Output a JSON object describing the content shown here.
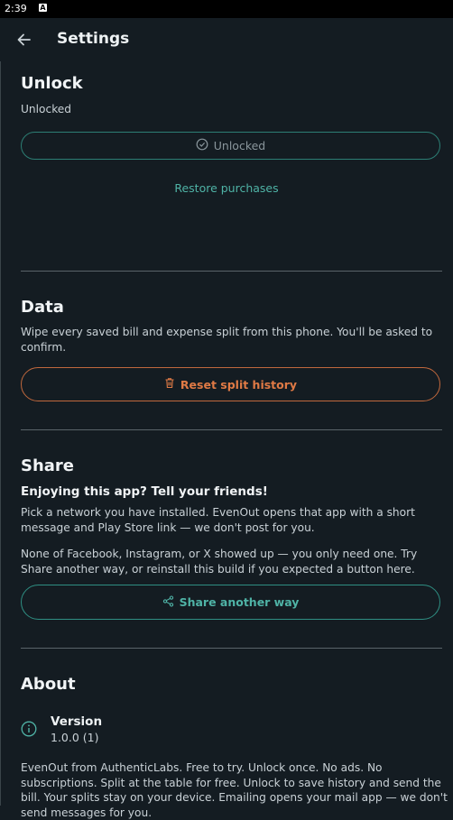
{
  "status_bar": {
    "time": "2:39",
    "notification_icon": "A"
  },
  "header": {
    "title": "Settings"
  },
  "unlock": {
    "heading": "Unlock",
    "status": "Unlocked",
    "button_label": "Unlocked",
    "restore_label": "Restore purchases"
  },
  "data": {
    "heading": "Data",
    "description": "Wipe every saved bill and expense split from this phone. You'll be asked to confirm.",
    "reset_label": "Reset split history"
  },
  "share": {
    "heading": "Share",
    "subheading": "Enjoying this app? Tell your friends!",
    "description1": "Pick a network you have installed. EvenOut opens that app with a short message and Play Store link — we don't post for you.",
    "description2": "None of Facebook, Instagram, or X showed up — you only need one. Try Share another way, or reinstall this build if you expected a button here.",
    "button_label": "Share another way"
  },
  "about": {
    "heading": "About",
    "version_label": "Version",
    "version_value": "1.0.0 (1)",
    "description": "EvenOut from AuthenticLabs. Free to try. Unlock once. No ads. No subscriptions. Split at the table for free. Unlock to save history and send the bill. Your splits stay on your device. Emailing opens your mail app — we don't send messages for you."
  },
  "colors": {
    "background": "#141c22",
    "accent_teal": "#4fb3a6",
    "accent_orange": "#e07a45"
  }
}
